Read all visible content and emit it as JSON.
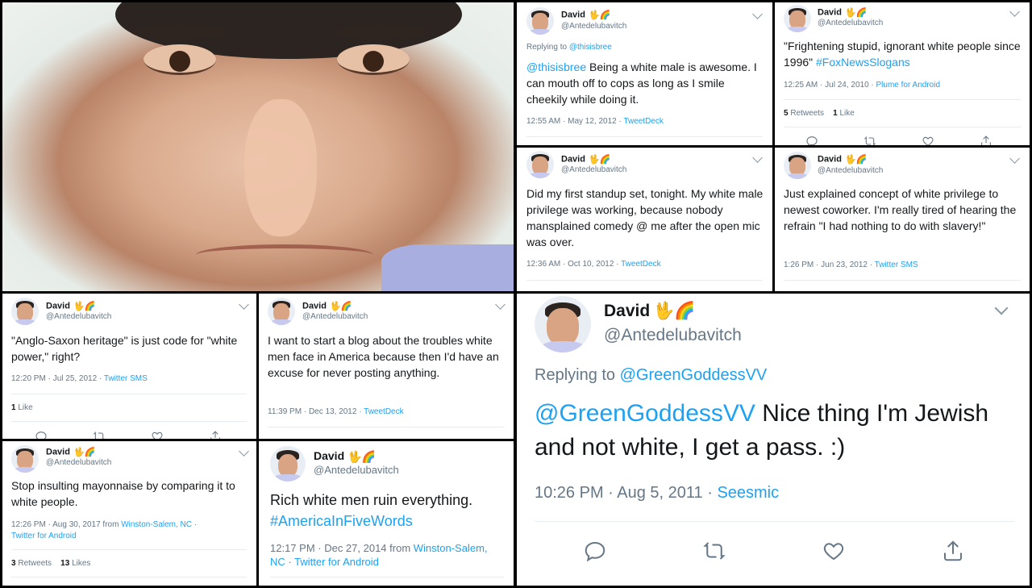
{
  "user": {
    "name": "David",
    "emoji": "🖖🌈",
    "handle": "@Antedelubavitch"
  },
  "tweets": [
    {
      "id": "t1",
      "replying_prefix": "Replying to",
      "replying_to": "@thisisbree",
      "mention": "@thisisbree",
      "body": " Being a white male is awesome. I can mouth off to cops as long as I smile cheekily while doing it.",
      "time": "12:55 AM · May 12, 2012 · ",
      "source": "TweetDeck"
    },
    {
      "id": "t2",
      "body": "\"Frightening stupid, ignorant white people since 1996\" ",
      "hashtag": "#FoxNewsSlogans",
      "time": "12:25 AM · Jul 24, 2010 · ",
      "source": "Plume for Android",
      "retweets": "5",
      "retweets_label": "Retweets",
      "likes": "1",
      "likes_label": "Like"
    },
    {
      "id": "t3",
      "body": "Did my first standup set, tonight. My white male privilege was working, because nobody mansplained comedy @ me after the open mic was over.",
      "time": "12:36 AM · Oct 10, 2012 · ",
      "source": "TweetDeck"
    },
    {
      "id": "t4",
      "body": "Just explained concept of white privilege to newest coworker. I'm really tired of hearing the refrain \"I had nothing to do with slavery!\"",
      "time": "1:26 PM · Jun 23, 2012 · ",
      "source": "Twitter SMS"
    },
    {
      "id": "t5",
      "body": "\"Anglo-Saxon heritage\" is just code for \"white power,\" right?",
      "time": "12:20 PM · Jul 25, 2012 · ",
      "source": "Twitter SMS",
      "likes": "1",
      "likes_label": "Like"
    },
    {
      "id": "t6",
      "body": "I want to start a blog about the troubles white men face in America because then I'd have an excuse for never posting anything.",
      "time": "11:39 PM · Dec 13, 2012 · ",
      "source": "TweetDeck"
    },
    {
      "id": "t7",
      "body": "Stop insulting mayonnaise by comparing it to white people.",
      "time": "12:26 PM · Aug 30, 2017 from ",
      "location": "Winston-Salem, NC",
      "source_sep": " · ",
      "source": "Twitter for Android",
      "retweets": "3",
      "retweets_label": "Retweets",
      "likes": "13",
      "likes_label": "Likes"
    },
    {
      "id": "t8",
      "body": "Rich white men ruin everything. ",
      "hashtag": "#AmericaInFiveWords",
      "time": "12:17 PM · Dec 27, 2014 from ",
      "location": "Winston-Salem, NC",
      "source_sep": " · ",
      "source": "Twitter for Android"
    },
    {
      "id": "t9",
      "replying_prefix": "Replying to",
      "replying_to": "@GreenGoddessVV",
      "mention": "@GreenGoddessVV",
      "body": " Nice thing I'm Jewish and not white, I get a pass. :)",
      "time": "10:26 PM · Aug 5, 2011 · ",
      "source": "Seesmic"
    }
  ],
  "icons": [
    "reply-icon",
    "retweet-icon",
    "like-icon",
    "share-icon",
    "chevron-down-icon"
  ],
  "colors": {
    "link": "#1da1f2",
    "muted": "#657786",
    "text": "#14171a",
    "divider": "#e6ecf0"
  }
}
